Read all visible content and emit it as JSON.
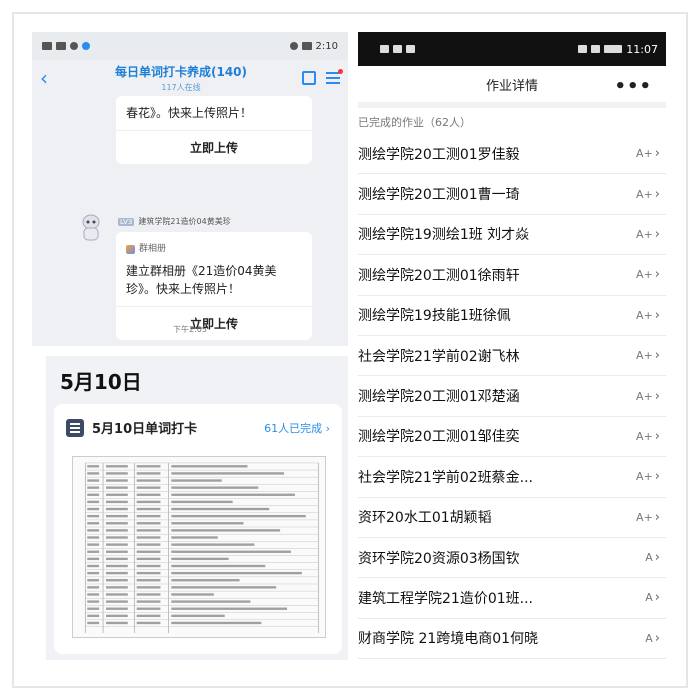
{
  "left_chat": {
    "status_time": "2:10",
    "title": "每日单词打卡养成(140)",
    "online": "117人在线",
    "card1_text": "春花》。快来上传照片！",
    "card1_action": "立即上传",
    "sender_tag": "LV3",
    "sender_name": "建筑学院21造价04黄美珍",
    "album_label": "群相册",
    "card2_text": "建立群相册《21造价04黄美珍》。快来上传照片！",
    "card2_action": "立即上传",
    "time": "下午2:05"
  },
  "checkin": {
    "date_heading": "5月10日",
    "title": "5月10日单词打卡",
    "done": "61人已完成",
    "done_chevron": "›"
  },
  "right": {
    "status_time": "11:07",
    "header_title": "作业详情",
    "more": "•••",
    "section_label": "已完成的作业（62人）",
    "items": [
      {
        "name": "测绘学院20工测01罗佳毅",
        "grade": "A+"
      },
      {
        "name": "测绘学院20工测01曹一琦",
        "grade": "A+"
      },
      {
        "name": "测绘学院19测绘1班 刘才焱",
        "grade": "A+"
      },
      {
        "name": "测绘学院20工测01徐雨轩",
        "grade": "A+"
      },
      {
        "name": "测绘学院19技能1班徐佩",
        "grade": "A+"
      },
      {
        "name": "社会学院21学前02谢飞林",
        "grade": "A+"
      },
      {
        "name": "测绘学院20工测01邓楚涵",
        "grade": "A+"
      },
      {
        "name": "测绘学院20工测01邹佳奕",
        "grade": "A+"
      },
      {
        "name": "社会学院21学前02班蔡金...",
        "grade": "A+"
      },
      {
        "name": "资环20水工01胡颖韬",
        "grade": "A+"
      },
      {
        "name": "资环学院20资源03杨国钦",
        "grade": "A"
      },
      {
        "name": "建筑工程学院21造价01班...",
        "grade": "A"
      },
      {
        "name": "财商学院 21跨境电商01何晓",
        "grade": "A"
      }
    ]
  },
  "colors": {
    "accent_blue": "#2c8ee8",
    "dark_status": "#111111"
  }
}
